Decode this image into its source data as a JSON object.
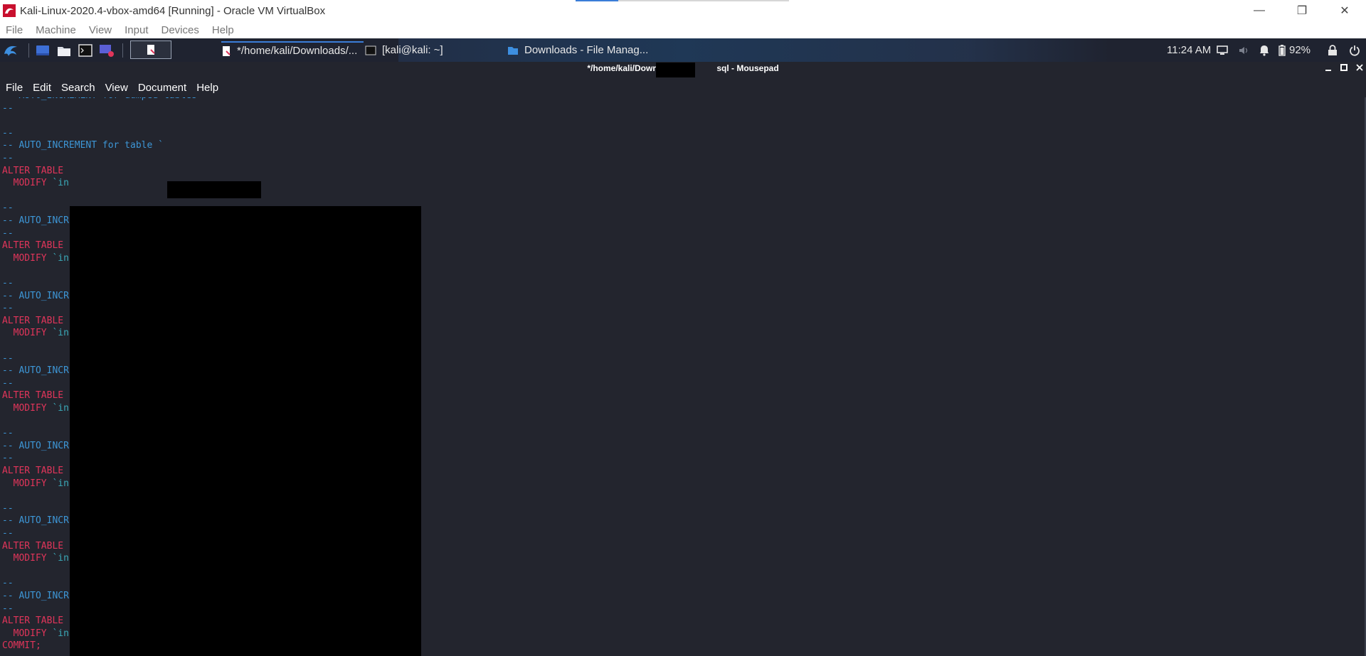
{
  "host_window": {
    "title": "Kali-Linux-2020.4-vbox-amd64 [Running] - Oracle VM VirtualBox",
    "controls": {
      "minimize": "—",
      "restore": "❐",
      "close": "✕"
    },
    "menu": [
      "File",
      "Machine",
      "View",
      "Input",
      "Devices",
      "Help"
    ]
  },
  "panel": {
    "tasks": [
      {
        "label": "*/home/kali/Downloads/...",
        "icon": "mousepad-icon",
        "active": true
      },
      {
        "label": "[kali@kali: ~]",
        "icon": "terminal-icon",
        "active": false
      },
      {
        "label": "Downloads - File Manag...",
        "icon": "folder-icon",
        "active": false
      }
    ],
    "clock": "11:24 AM",
    "battery": "92%"
  },
  "mousepad": {
    "title_left": "*/home/kali/Download",
    "title_right": "sql - Mousepad",
    "menu": [
      "File",
      "Edit",
      "Search",
      "View",
      "Document",
      "Help"
    ]
  },
  "editor": {
    "lines": [
      {
        "text": "-- AUTO_INCREMENT for dumped tables",
        "kind": "comment"
      },
      {
        "text": "--",
        "kind": "comment"
      },
      {
        "text": "",
        "kind": "plain"
      },
      {
        "text": "--",
        "kind": "comment"
      },
      {
        "text": "-- AUTO_INCREMENT for table `",
        "kind": "comment"
      },
      {
        "text": "--",
        "kind": "comment"
      },
      {
        "text": "ALTER TABLE",
        "kind": "keyword"
      },
      {
        "text": "  MODIFY `in",
        "kind": "mixed"
      },
      {
        "text": "",
        "kind": "plain"
      },
      {
        "text": "--",
        "kind": "comment"
      },
      {
        "text": "-- AUTO_INCR",
        "kind": "comment"
      },
      {
        "text": "--",
        "kind": "comment"
      },
      {
        "text": "ALTER TABLE",
        "kind": "keyword"
      },
      {
        "text": "  MODIFY `in",
        "kind": "mixed"
      },
      {
        "text": "",
        "kind": "plain"
      },
      {
        "text": "--",
        "kind": "comment"
      },
      {
        "text": "-- AUTO_INCR",
        "kind": "comment"
      },
      {
        "text": "--",
        "kind": "comment"
      },
      {
        "text": "ALTER TABLE",
        "kind": "keyword"
      },
      {
        "text": "  MODIFY `in",
        "kind": "mixed"
      },
      {
        "text": "",
        "kind": "plain"
      },
      {
        "text": "--",
        "kind": "comment"
      },
      {
        "text": "-- AUTO_INCR",
        "kind": "comment"
      },
      {
        "text": "--",
        "kind": "comment"
      },
      {
        "text": "ALTER TABLE",
        "kind": "keyword"
      },
      {
        "text": "  MODIFY `in",
        "kind": "mixed"
      },
      {
        "text": "",
        "kind": "plain"
      },
      {
        "text": "--",
        "kind": "comment"
      },
      {
        "text": "-- AUTO_INCR",
        "kind": "comment"
      },
      {
        "text": "--",
        "kind": "comment"
      },
      {
        "text": "ALTER TABLE",
        "kind": "keyword"
      },
      {
        "text": "  MODIFY `in",
        "kind": "mixed"
      },
      {
        "text": "",
        "kind": "plain"
      },
      {
        "text": "--",
        "kind": "comment"
      },
      {
        "text": "-- AUTO_INCR",
        "kind": "comment"
      },
      {
        "text": "--",
        "kind": "comment"
      },
      {
        "text": "ALTER TABLE",
        "kind": "keyword"
      },
      {
        "text": "  MODIFY `in",
        "kind": "mixed"
      },
      {
        "text": "",
        "kind": "plain"
      },
      {
        "text": "--",
        "kind": "comment"
      },
      {
        "text": "-- AUTO_INCR",
        "kind": "comment"
      },
      {
        "text": "--",
        "kind": "comment"
      },
      {
        "text": "ALTER TABLE",
        "kind": "keyword"
      },
      {
        "text": "  MODIFY `in",
        "kind": "mixed"
      },
      {
        "text": "COMMIT;",
        "kind": "keyword"
      }
    ]
  },
  "colors": {
    "editor_bg": "#23252e",
    "comment": "#3d96d6",
    "keyword": "#e0355a",
    "plain": "#3aa9b8"
  }
}
